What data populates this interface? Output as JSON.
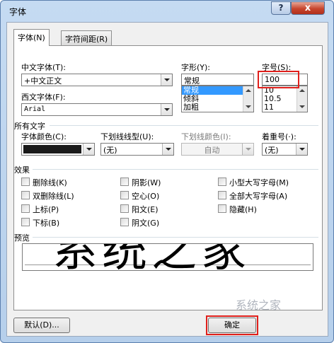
{
  "window": {
    "title": "字体",
    "help_label": "?",
    "close_label": "x"
  },
  "tabs": [
    {
      "label": "字体(N)",
      "active": true
    },
    {
      "label": "字符间距(R)",
      "active": false
    }
  ],
  "chinese_font": {
    "label": "中文字体(T):",
    "value": "+中文正文"
  },
  "western_font": {
    "label": "西文字体(F):",
    "value": "Arial"
  },
  "font_style": {
    "label": "字形(Y):",
    "value": "常规",
    "options": [
      "常规",
      "倾斜",
      "加粗"
    ],
    "selected": "常规"
  },
  "font_size": {
    "label": "字号(S):",
    "value": "100",
    "options": [
      "10",
      "10.5",
      "11"
    ]
  },
  "all_text": {
    "heading": "所有文字",
    "font_color_label": "字体颜色(C):",
    "font_color_value": "#1a1a1a",
    "underline_type_label": "下划线线型(U):",
    "underline_type_value": "(无)",
    "underline_color_label": "下划线颜色(I):",
    "underline_color_value": "自动",
    "emphasis_label": "着重号(·):",
    "emphasis_value": "(无)"
  },
  "effects": {
    "heading": "效果",
    "items": [
      "删除线(K)",
      "双删除线(L)",
      "上标(P)",
      "下标(B)",
      "阴影(W)",
      "空心(O)",
      "阳文(E)",
      "阴文(G)",
      "小型大写字母(M)",
      "全部大写字母(A)",
      "隐藏(H)"
    ]
  },
  "preview": {
    "heading": "预览",
    "sample": "系统之家"
  },
  "buttons": {
    "default_label": "默认(D)...",
    "ok_label": "确定"
  },
  "watermark": {
    "text": "系统之家"
  },
  "colors": {
    "annotation_red": "#e0201c",
    "title_bar": "#c5dbf2"
  }
}
